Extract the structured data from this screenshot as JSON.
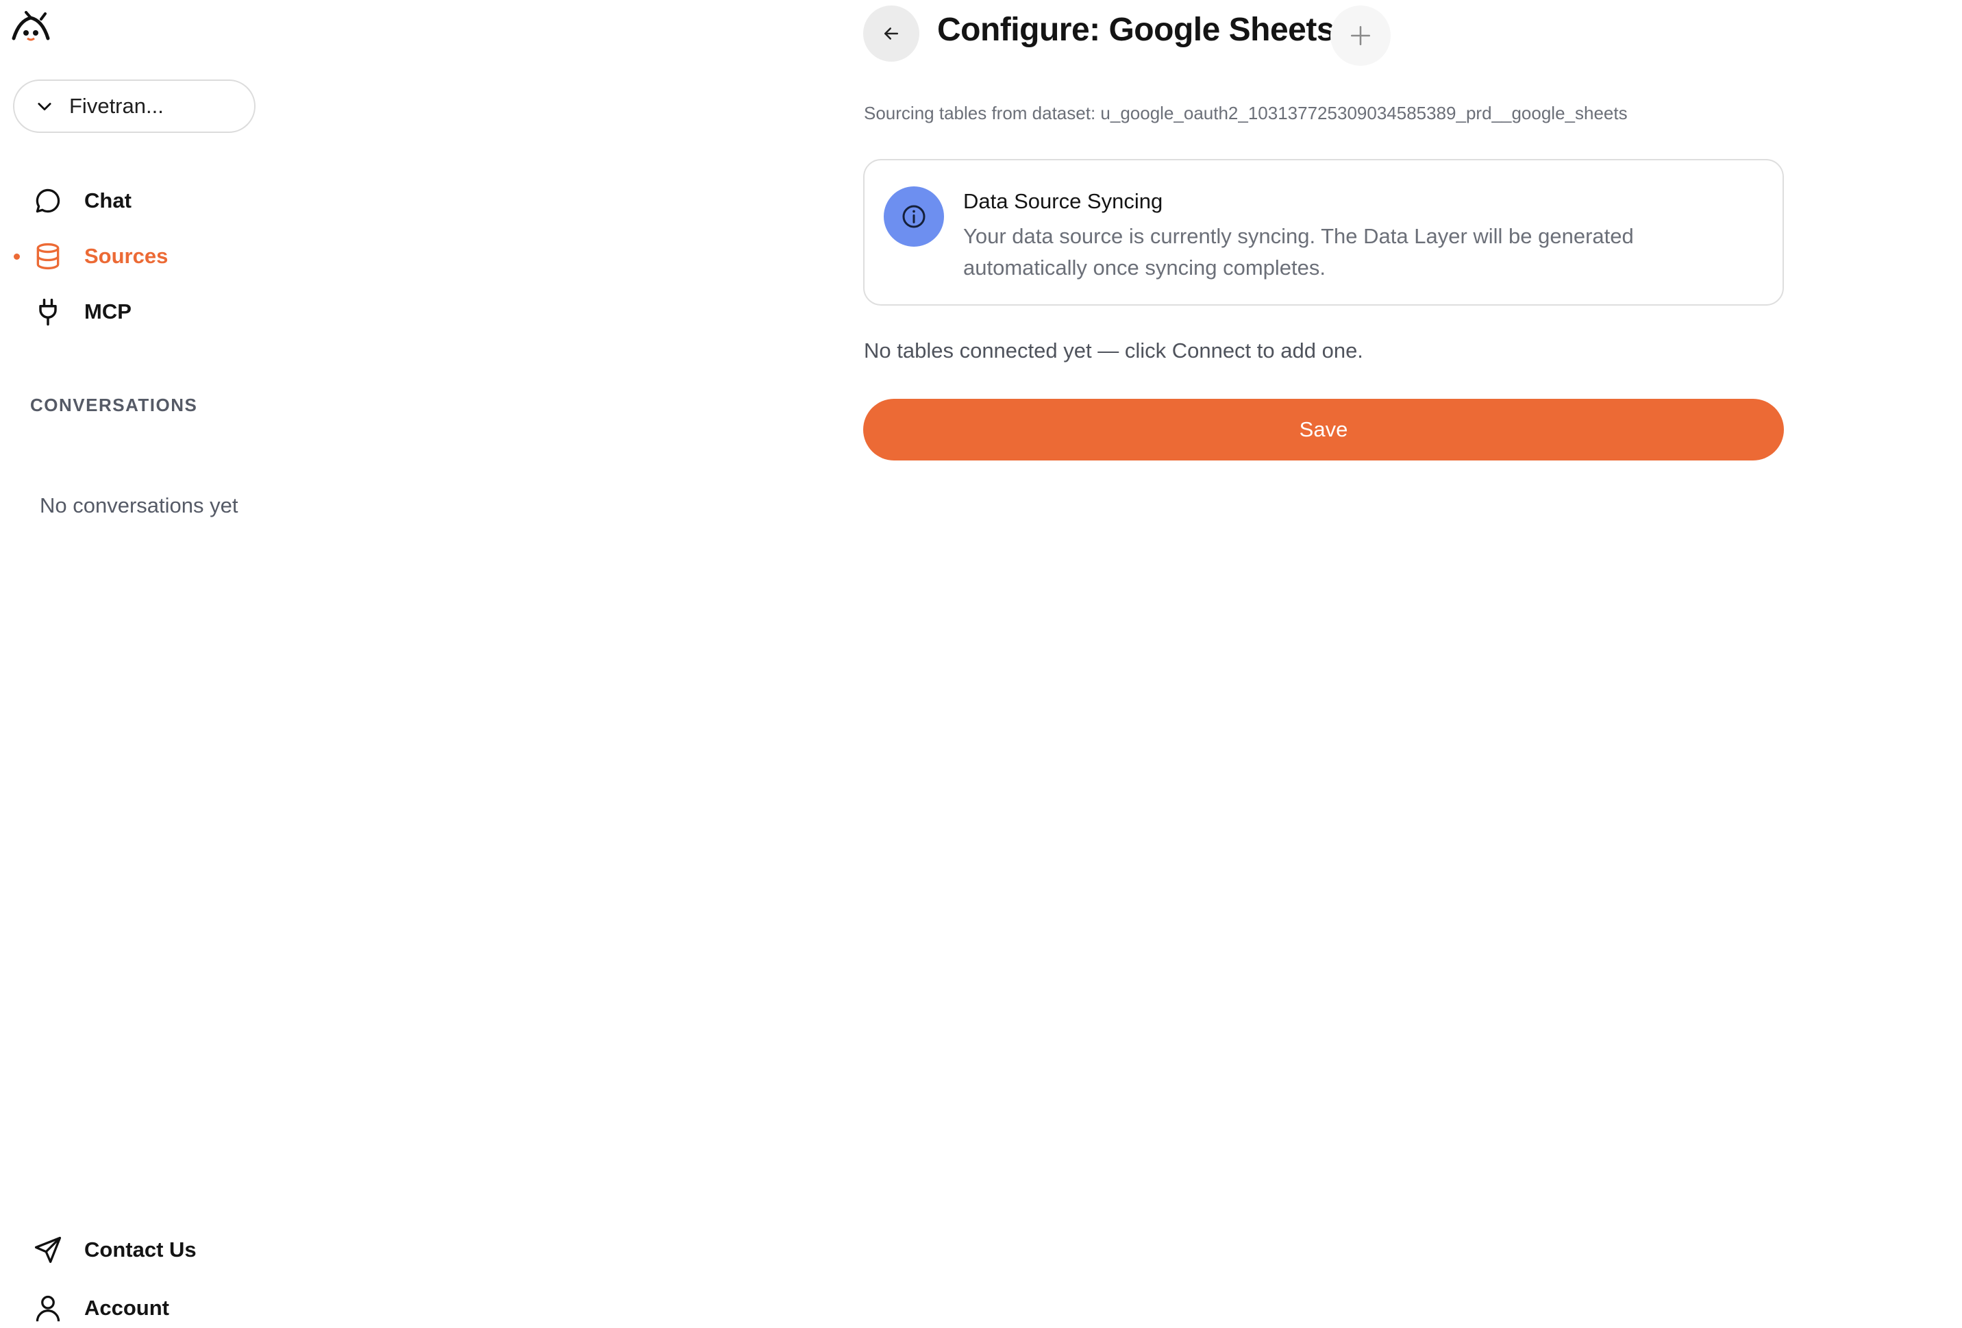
{
  "brand": {
    "logo_icon": "fivetran-bot-logo-icon"
  },
  "workspace_select": {
    "value": "Fivetran...",
    "icon": "chevron-down-icon"
  },
  "nav": {
    "items": [
      {
        "label": "Chat",
        "icon": "chat-bubble-icon",
        "active": false
      },
      {
        "label": "Sources",
        "icon": "database-icon",
        "active": true
      },
      {
        "label": "MCP",
        "icon": "plug-icon",
        "active": false
      }
    ]
  },
  "conversations": {
    "heading": "CONVERSATIONS",
    "empty_text": "No conversations yet"
  },
  "footer": {
    "contact_label": "Contact Us",
    "contact_icon": "send-icon",
    "account_label": "Account",
    "account_icon": "user-icon"
  },
  "header": {
    "back_icon": "arrow-left-icon",
    "title": "Configure: Google Sheets",
    "add_icon": "plus-icon"
  },
  "dataset": {
    "text": "Sourcing tables from dataset: u_google_oauth2_103137725309034585389_prd__google_sheets"
  },
  "sync_notice": {
    "icon": "info-icon",
    "title": "Data Source Syncing",
    "body": "Your data source is currently syncing. The Data Layer will be generated automatically once syncing completes."
  },
  "tables": {
    "empty_text": "No tables connected yet — click Connect to add one."
  },
  "actions": {
    "save_label": "Save"
  },
  "colors": {
    "accent": "#ec6a35",
    "info": "#6d8ff0",
    "muted_text": "#6b6f78"
  }
}
